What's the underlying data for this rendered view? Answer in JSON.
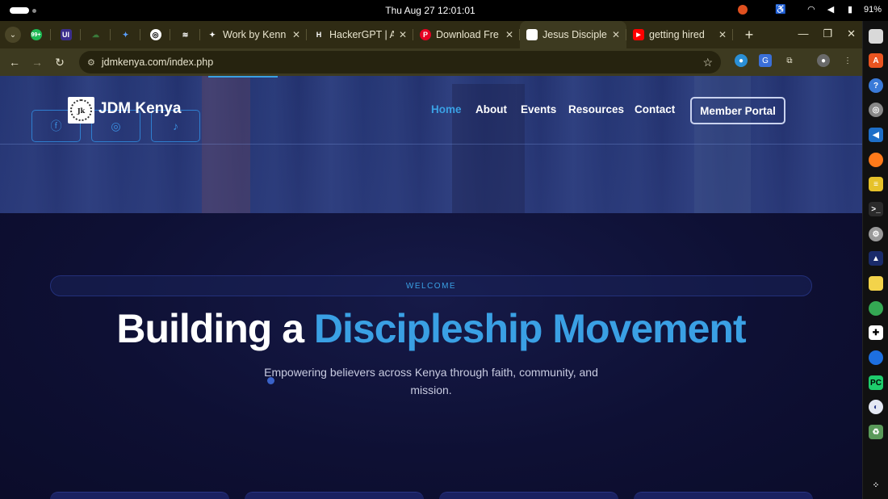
{
  "os": {
    "clock": "Thu Aug 27  12:01:01",
    "battery": "91%"
  },
  "browser": {
    "tabs": [
      {
        "title": "Work by Kenn",
        "favicon_color": "#1e1e1e",
        "favicon_glyph": "✦"
      },
      {
        "title": "HackerGPT | A",
        "favicon_color": "#1e1e1e",
        "favicon_glyph": "H"
      },
      {
        "title": "Download Fre",
        "favicon_color": "#e60023",
        "favicon_glyph": "P"
      },
      {
        "title": "Jesus Disciple",
        "favicon_color": "#ffffff",
        "favicon_glyph": "",
        "active": true
      },
      {
        "title": "getting hired",
        "favicon_color": "#ff0000",
        "favicon_glyph": "▶"
      }
    ],
    "url": "jdmkenya.com/index.php"
  },
  "site": {
    "brand": "JDM Kenya",
    "logo_text": "Jk",
    "nav": {
      "home": "Home",
      "about": "About",
      "events": "Events",
      "resources": "Resources",
      "contact": "Contact"
    },
    "portal_label": "Member Portal",
    "social": [
      "facebook",
      "instagram",
      "tiktok"
    ],
    "welcome": "WELCOME",
    "headline_plain": "Building a ",
    "headline_accent": "Discipleship Movement",
    "subline": "Empowering believers across Kenya through faith, community, and mission.",
    "accent_color": "#3aa0e4"
  }
}
